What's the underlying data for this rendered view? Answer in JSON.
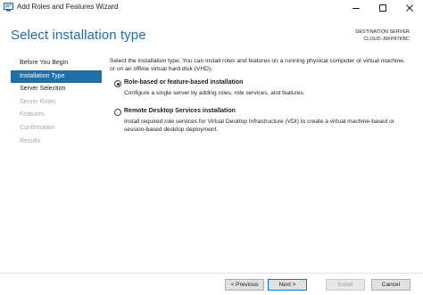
{
  "window": {
    "title": "Add Roles and Features Wizard",
    "controls": [
      "minimize-icon",
      "maximize-icon",
      "close-icon"
    ]
  },
  "header": {
    "page_title": "Select installation type",
    "destination_label": "DESTINATION SERVER",
    "destination_server": "CLOUD-J0KP87KBC"
  },
  "nav": {
    "items": [
      {
        "label": "Before You Begin",
        "state": "normal"
      },
      {
        "label": "Installation Type",
        "state": "active"
      },
      {
        "label": "Server Selection",
        "state": "normal"
      },
      {
        "label": "Server Roles",
        "state": "disabled"
      },
      {
        "label": "Features",
        "state": "disabled"
      },
      {
        "label": "Confirmation",
        "state": "disabled"
      },
      {
        "label": "Results",
        "state": "disabled"
      }
    ]
  },
  "main": {
    "intro": "Select the installation type. You can install roles and features on a running physical computer or virtual machine, or on an offline virtual hard disk (VHD).",
    "options": [
      {
        "label": "Role-based or feature-based installation",
        "description": "Configure a single server by adding roles, role services, and features.",
        "selected": true
      },
      {
        "label": "Remote Desktop Services installation",
        "description": "Install required role services for Virtual Desktop Infrastructure (VDI) to create a virtual machine-based or session-based desktop deployment.",
        "selected": false
      }
    ]
  },
  "footer": {
    "previous": "< Previous",
    "next": "Next >",
    "install": "Install",
    "cancel": "Cancel"
  },
  "colors": {
    "accent": "#1f6ea8",
    "disabled_text": "#a6a6a6"
  }
}
